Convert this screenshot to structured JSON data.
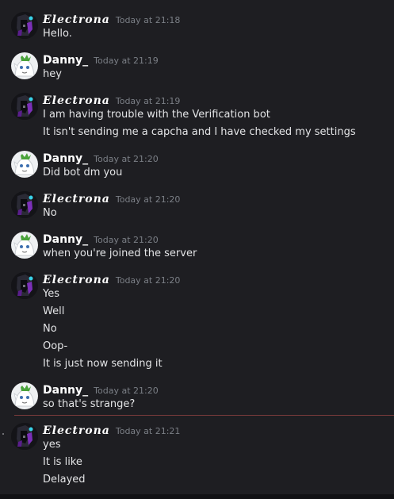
{
  "messages": [
    {
      "author": "Electrona",
      "timestamp": "Today at 21:18",
      "lines": [
        "Hello."
      ]
    },
    {
      "author": "Danny_",
      "timestamp": "Today at 21:19",
      "lines": [
        "hey"
      ]
    },
    {
      "author": "Electrona",
      "timestamp": "Today at 21:19",
      "lines": [
        "I am having trouble with the Verification bot",
        "It isn't sending me a capcha and I have checked my settings"
      ]
    },
    {
      "author": "Danny_",
      "timestamp": "Today at 21:20",
      "lines": [
        "Did bot dm you"
      ]
    },
    {
      "author": "Electrona",
      "timestamp": "Today at 21:20",
      "lines": [
        "No"
      ]
    },
    {
      "author": "Danny_",
      "timestamp": "Today at 21:20",
      "lines": [
        "when you're joined the server"
      ]
    },
    {
      "author": "Electrona",
      "timestamp": "Today at 21:20",
      "lines": [
        "Yes",
        "Well",
        "No",
        "Oop-",
        "It is just now sending it"
      ]
    },
    {
      "author": "Danny_",
      "timestamp": "Today at 21:20",
      "lines": [
        "so that's strange?"
      ]
    },
    {
      "author": "Electrona",
      "timestamp": "Today at 21:21",
      "lines": [
        "yes",
        "It is like",
        "Delayed"
      ]
    }
  ],
  "colors": {
    "background": "#1e1e22",
    "text": "#e3e4e6",
    "username": "#ffffff",
    "timestamp": "#7b7f86",
    "new_messages_divider": "#7a3b3b"
  },
  "icons": {
    "electrona_avatar": "electrona-avatar-icon",
    "danny_avatar": "danny-avatar-icon"
  }
}
